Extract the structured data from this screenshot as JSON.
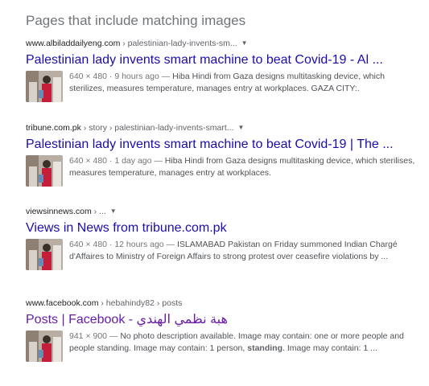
{
  "heading": "Pages that include matching images",
  "results": [
    {
      "site": "www.albiladdailyeng.com",
      "path": " › palestinian-lady-invents-sm...",
      "title": "Palestinian lady invents smart machine to beat Covid-19 - Al ...",
      "meta": "640 × 480 · 9 hours ago — ",
      "snippet": "Hiba Hindi from Gaza designs multitasking device, which sterilizes, measures temperature, manages entry at workplaces. GAZA CITY:."
    },
    {
      "site": "tribune.com.pk",
      "path": " › story › palestinian-lady-invents-smart...",
      "title": "Palestinian lady invents smart machine to beat Covid-19 | The ...",
      "meta": "640 × 480 · 1 day ago — ",
      "snippet": "Hiba Hindi from Gaza designs multitasking device, which sterilises, measures temperature, manages entry at workplaces."
    },
    {
      "site": "viewsinnews.com",
      "path": " › ...",
      "title": "Views in News from tribune.com.pk",
      "meta": "640 × 480 · 12 hours ago — ",
      "snippet": "ISLAMABAD Pakistan on Friday summoned Indian Chargé d'Affaires to Ministry of Foreign Affairs to strong protest over ceasefire violations by ..."
    },
    {
      "site": "www.facebook.com",
      "path": " › hebahindy82 › posts",
      "title": "Posts | Facebook - هبة نظمي الهندي",
      "meta": "941 × 900 — ",
      "snippet_parts": [
        "No photo description available. Image may contain: one or more people and people standing. Image may contain: 1 person, ",
        "standing",
        ". Image may contain: 1 ..."
      ]
    }
  ],
  "colors": {
    "link": "#1a0dab",
    "visited_link": "#681da8",
    "snippet_text": "#4d5156",
    "meta_text": "#70757a"
  }
}
